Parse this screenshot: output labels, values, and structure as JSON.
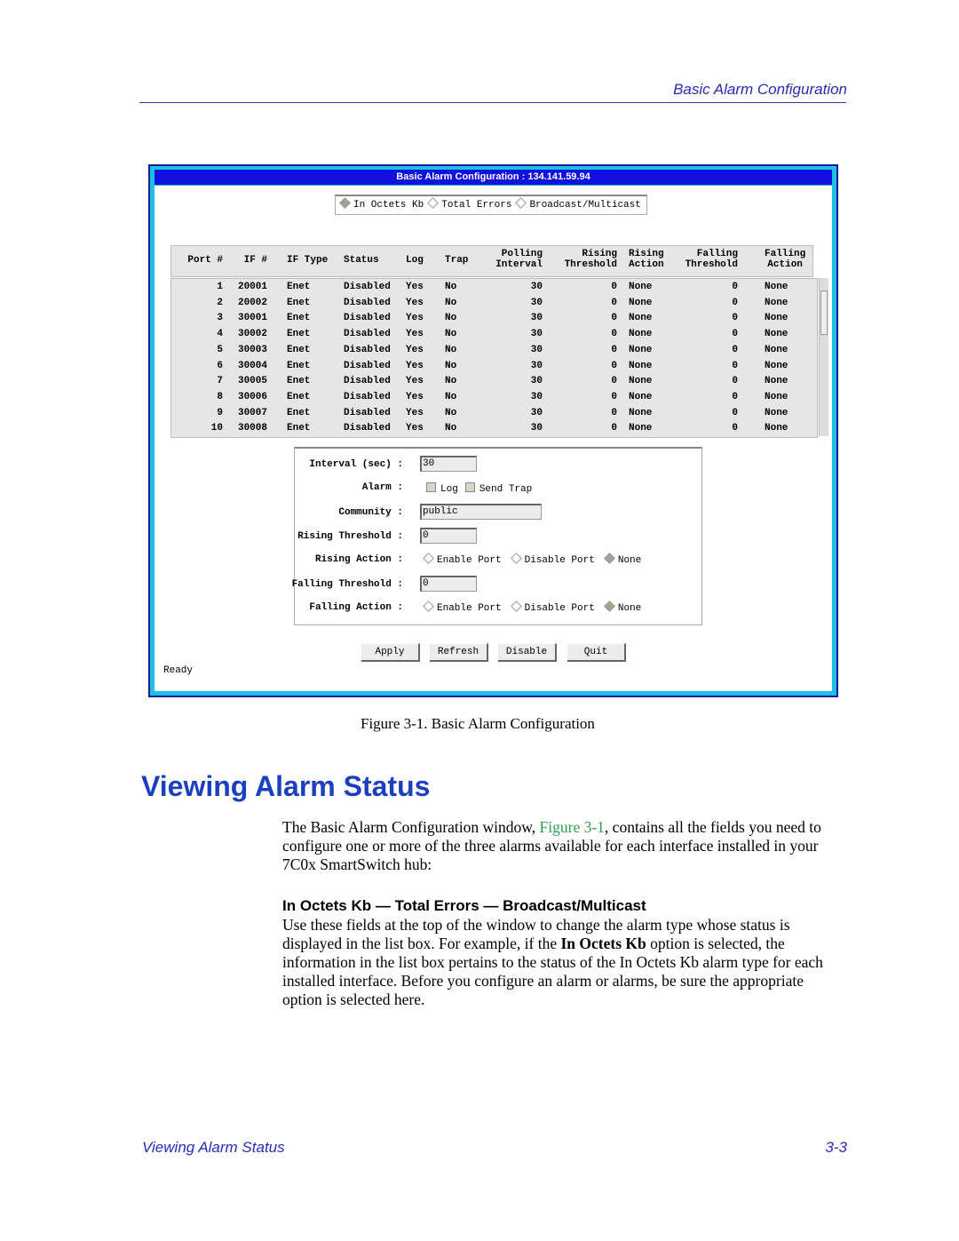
{
  "running_header": "Basic Alarm Configuration",
  "window": {
    "title": "Basic Alarm Configuration : 134.141.59.94",
    "alarm_types": [
      {
        "label": "In Octets Kb",
        "selected": true
      },
      {
        "label": "Total Errors",
        "selected": false
      },
      {
        "label": "Broadcast/Multicast",
        "selected": false
      }
    ],
    "columns": [
      "Port #",
      "IF #",
      "IF Type",
      "Status",
      "Log",
      "Trap",
      "Polling Interval",
      "Rising Threshold",
      "Rising Action",
      "Falling Threshold",
      "Falling Action"
    ],
    "rows": [
      [
        "1",
        "20001",
        "Enet",
        "Disabled",
        "Yes",
        "No",
        "30",
        "0",
        "None",
        "0",
        "None"
      ],
      [
        "2",
        "20002",
        "Enet",
        "Disabled",
        "Yes",
        "No",
        "30",
        "0",
        "None",
        "0",
        "None"
      ],
      [
        "3",
        "30001",
        "Enet",
        "Disabled",
        "Yes",
        "No",
        "30",
        "0",
        "None",
        "0",
        "None"
      ],
      [
        "4",
        "30002",
        "Enet",
        "Disabled",
        "Yes",
        "No",
        "30",
        "0",
        "None",
        "0",
        "None"
      ],
      [
        "5",
        "30003",
        "Enet",
        "Disabled",
        "Yes",
        "No",
        "30",
        "0",
        "None",
        "0",
        "None"
      ],
      [
        "6",
        "30004",
        "Enet",
        "Disabled",
        "Yes",
        "No",
        "30",
        "0",
        "None",
        "0",
        "None"
      ],
      [
        "7",
        "30005",
        "Enet",
        "Disabled",
        "Yes",
        "No",
        "30",
        "0",
        "None",
        "0",
        "None"
      ],
      [
        "8",
        "30006",
        "Enet",
        "Disabled",
        "Yes",
        "No",
        "30",
        "0",
        "None",
        "0",
        "None"
      ],
      [
        "9",
        "30007",
        "Enet",
        "Disabled",
        "Yes",
        "No",
        "30",
        "0",
        "None",
        "0",
        "None"
      ],
      [
        "10",
        "30008",
        "Enet",
        "Disabled",
        "Yes",
        "No",
        "30",
        "0",
        "None",
        "0",
        "None"
      ]
    ],
    "form": {
      "interval_label": "Interval (sec) :",
      "interval_value": "30",
      "alarm_label": "Alarm :",
      "log_label": "Log",
      "trap_label": "Send Trap",
      "community_label": "Community :",
      "community_value": "public",
      "rising_threshold_label": "Rising Threshold :",
      "rising_threshold_value": "0",
      "rising_action_label": "Rising Action :",
      "falling_threshold_label": "Falling Threshold :",
      "falling_threshold_value": "0",
      "falling_action_label": "Falling Action :",
      "action_options": [
        "Enable Port",
        "Disable Port",
        "None"
      ],
      "selected_action": "None"
    },
    "buttons": {
      "apply": "Apply",
      "refresh": "Refresh",
      "disable": "Disable",
      "quit": "Quit"
    },
    "status": "Ready"
  },
  "figure_caption": "Figure 3-1.  Basic Alarm Configuration",
  "section_title": "Viewing Alarm Status",
  "para1": {
    "before": "The Basic Alarm Configuration window, ",
    "link": "Figure 3-1",
    "after": ", contains all the fields you need to configure one or more of the three alarms available for each interface installed in your 7C0x SmartSwitch hub:"
  },
  "subheading": "In Octets Kb — Total Errors — Broadcast/Multicast",
  "para2": {
    "t1": "Use these fields at the top of the window to change the alarm type whose status is displayed in the list box. For example, if the ",
    "b1": "In Octets Kb",
    "t2": " option is selected, the information in the list box pertains to the status of the In Octets Kb alarm type for each installed interface. Before you configure an alarm or alarms, be sure the appropriate option is selected here."
  },
  "footer": {
    "left": "Viewing Alarm Status",
    "right": "3-3"
  },
  "colors": {
    "title_bar": "#1010e0",
    "heading_blue": "#1a3fc0",
    "link_green": "#2e9e4e"
  }
}
